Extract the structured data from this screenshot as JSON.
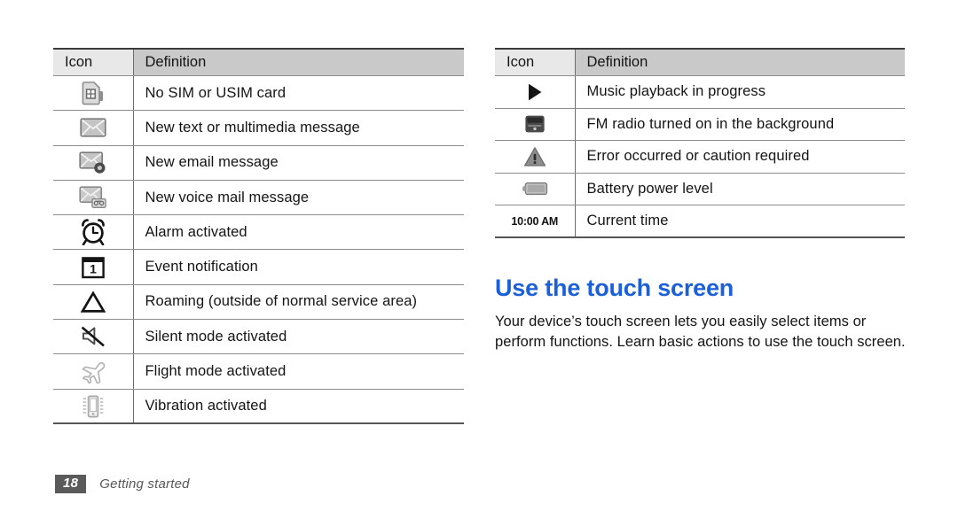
{
  "page": {
    "footer_page_number": "18",
    "footer_section": "Getting started"
  },
  "tables": {
    "left": {
      "headers": {
        "icon": "Icon",
        "definition": "Definition"
      },
      "rows": [
        {
          "icon_name": "sim-card-icon",
          "definition": "No SIM or USIM card"
        },
        {
          "icon_name": "envelope-icon",
          "definition": "New text or multimedia message"
        },
        {
          "icon_name": "email-message-icon",
          "definition": "New email message"
        },
        {
          "icon_name": "voice-mail-icon",
          "definition": "New voice mail message"
        },
        {
          "icon_name": "alarm-clock-icon",
          "definition": "Alarm activated"
        },
        {
          "icon_name": "calendar-event-icon",
          "definition": "Event notification"
        },
        {
          "icon_name": "roaming-triangle-icon",
          "definition": "Roaming (outside of normal service area)"
        },
        {
          "icon_name": "silent-mode-icon",
          "definition": "Silent mode activated"
        },
        {
          "icon_name": "flight-mode-icon",
          "definition": "Flight mode activated"
        },
        {
          "icon_name": "vibration-icon",
          "definition": "Vibration activated"
        }
      ]
    },
    "right": {
      "headers": {
        "icon": "Icon",
        "definition": "Definition"
      },
      "rows": [
        {
          "icon_name": "play-icon",
          "definition": "Music playback in progress"
        },
        {
          "icon_name": "fm-radio-icon",
          "definition": "FM radio turned on in the background"
        },
        {
          "icon_name": "warning-icon",
          "definition": "Error occurred or caution required"
        },
        {
          "icon_name": "battery-icon",
          "definition": "Battery power level"
        },
        {
          "icon_name": "current-time-text",
          "icon_text": "10:00 AM",
          "definition": "Current time"
        }
      ]
    }
  },
  "section": {
    "heading": "Use the touch screen",
    "body": "Your device’s touch screen lets you easily select items or perform functions. Learn basic actions to use the touch screen."
  },
  "colors": {
    "heading_blue": "#1b5fd9",
    "header_icon_bg": "#e8e8e8",
    "header_def_bg": "#c9c9c9",
    "rule": "#8d8d8d",
    "footer_box": "#5a5a5a"
  }
}
